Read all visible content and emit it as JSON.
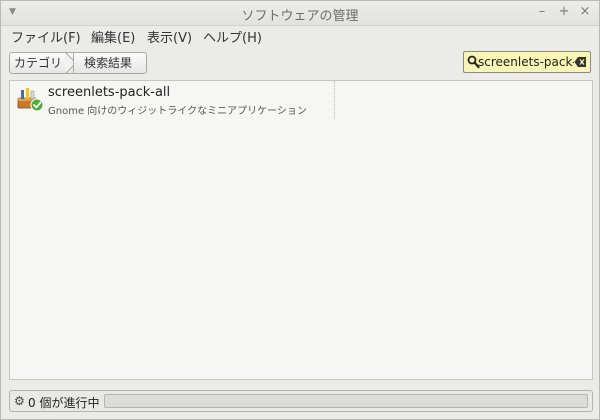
{
  "window": {
    "title": "ソフトウェアの管理",
    "controls": {
      "minimize": "–",
      "maximize": "+",
      "close": "×"
    }
  },
  "menubar": {
    "items": [
      {
        "label": "ファイル(F)"
      },
      {
        "label": "編集(E)"
      },
      {
        "label": "表示(V)"
      },
      {
        "label": "ヘルプ(H)"
      }
    ]
  },
  "breadcrumb": {
    "items": [
      {
        "label": "カテゴリ"
      },
      {
        "label": "検索結果"
      }
    ]
  },
  "search": {
    "value": "screenlets-pack-all",
    "icon": "search-icon",
    "clear_icon": "clear-icon"
  },
  "results": [
    {
      "name": "screenlets-pack-all",
      "description": "Gnome 向けのウィジットライクなミニアプリケーション",
      "icon": "package-installed-icon",
      "installed": true
    }
  ],
  "status": {
    "text": "0 個が進行中",
    "progress": 0,
    "icon": "gear-icon"
  },
  "colors": {
    "search_bg": "#f8f5b7",
    "window_bg": "#ebebe8",
    "list_bg": "#f6f6f4",
    "installed_check": "#4caf3a"
  }
}
